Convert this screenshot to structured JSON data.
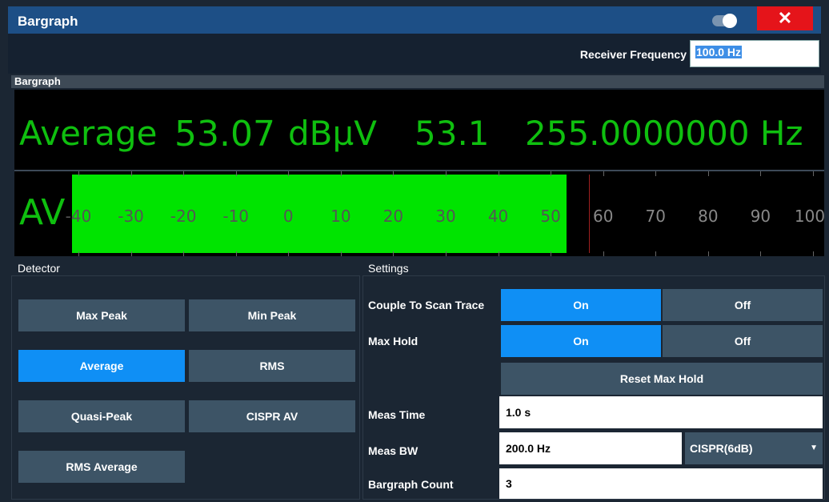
{
  "window": {
    "title": "Bargraph",
    "close_glyph": "✕"
  },
  "receiver": {
    "label": "Receiver Frequency",
    "value": "100.0 Hz"
  },
  "bargraph": {
    "header": "Bargraph",
    "detector_name": "Average",
    "level": "53.07",
    "unit": "dBµV",
    "max_hold": "53.1",
    "frequency": "255.0000000 Hz",
    "bar_label": "AV",
    "scale_min": -40,
    "scale_max": 100,
    "level_value": 53.07,
    "max_hold_value": 53.1,
    "ticks": [
      "-40",
      "-30",
      "-20",
      "-10",
      "0",
      "10",
      "20",
      "30",
      "40",
      "50",
      "60",
      "70",
      "80",
      "90",
      "100"
    ],
    "bar_color": "#00e400",
    "text_color": "#0fbf0f"
  },
  "detector": {
    "title": "Detector",
    "buttons": [
      {
        "label": "Max Peak",
        "active": false
      },
      {
        "label": "Min Peak",
        "active": false
      },
      {
        "label": "Average",
        "active": true
      },
      {
        "label": "RMS",
        "active": false
      },
      {
        "label": "Quasi-Peak",
        "active": false
      },
      {
        "label": "CISPR AV",
        "active": false
      },
      {
        "label": "RMS Average",
        "active": false
      }
    ]
  },
  "settings": {
    "title": "Settings",
    "couple_label": "Couple To Scan Trace",
    "couple_on": "On",
    "couple_off": "Off",
    "maxhold_label": "Max Hold",
    "maxhold_on": "On",
    "maxhold_off": "Off",
    "reset_label": "Reset Max Hold",
    "meas_time_label": "Meas Time",
    "meas_time_value": "1.0 s",
    "meas_bw_label": "Meas BW",
    "meas_bw_value": "200.0 Hz",
    "meas_bw_filter": "CISPR(6dB)",
    "count_label": "Bargraph Count",
    "count_value": "3"
  },
  "colors": {
    "accent": "#0f8ff5",
    "titlebar": "#1d4f86",
    "close": "#e5141a"
  }
}
